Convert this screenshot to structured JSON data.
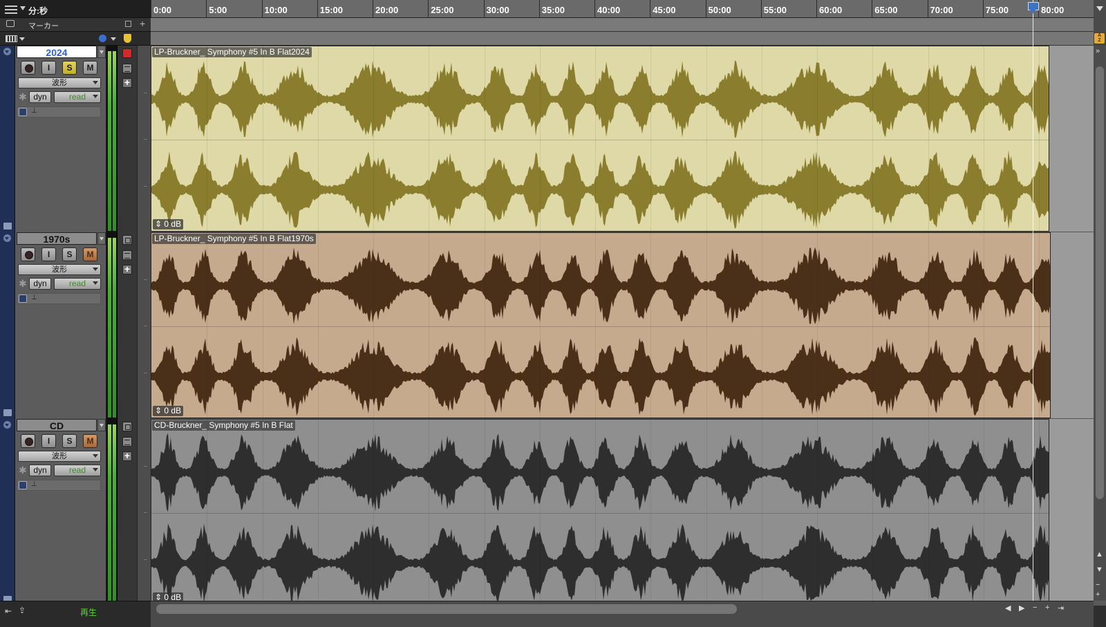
{
  "ruler": {
    "label": "分:秒",
    "ticks": [
      "0:00",
      "5:00",
      "10:00",
      "15:00",
      "20:00",
      "25:00",
      "30:00",
      "35:00",
      "40:00",
      "45:00",
      "50:00",
      "55:00",
      "60:00",
      "65:00",
      "70:00",
      "75:00",
      "80:00"
    ]
  },
  "markers": {
    "label": "マーカー"
  },
  "tracks": [
    {
      "name": "2024",
      "selected": true,
      "solo_on": true,
      "mute_on": false,
      "record_label": "",
      "input_label": "I",
      "solo_label": "S",
      "mute_label": "M",
      "view": "波形",
      "automation_dyn": "dyn",
      "automation_mode": "read",
      "clip_name": "LP-Bruckner_ Symphony #5 In B Flat2024",
      "clip_gain": "0 dB",
      "clip_color": "#ded9a6",
      "wave_color": "#8a7d2e"
    },
    {
      "name": "1970s",
      "selected": false,
      "solo_on": false,
      "mute_on": true,
      "record_label": "",
      "input_label": "I",
      "solo_label": "S",
      "mute_label": "M",
      "view": "波形",
      "automation_dyn": "dyn",
      "automation_mode": "read",
      "clip_name": "LP-Bruckner_ Symphony #5 In B Flat1970s",
      "clip_gain": "0 dB",
      "clip_color": "#c6aa8e",
      "wave_color": "#4a3018"
    },
    {
      "name": "CD",
      "selected": false,
      "solo_on": false,
      "mute_on": true,
      "record_label": "",
      "input_label": "I",
      "solo_label": "S",
      "mute_label": "M",
      "view": "波形",
      "automation_dyn": "dyn",
      "automation_mode": "read",
      "clip_name": "CD-Bruckner_ Symphony #5 In B Flat",
      "clip_gain": "0 dB",
      "clip_color": "#8f8f8f",
      "wave_color": "#2e2e2e"
    }
  ],
  "status": {
    "transport": "再生"
  },
  "playhead_minutes": 79.5,
  "icons": {
    "menu": "hamburger-icon",
    "comment": "comment-icon",
    "record": "record-icon",
    "collapse": "collapse-icon",
    "add": "plus-icon",
    "sort": "az-sort-icon"
  }
}
